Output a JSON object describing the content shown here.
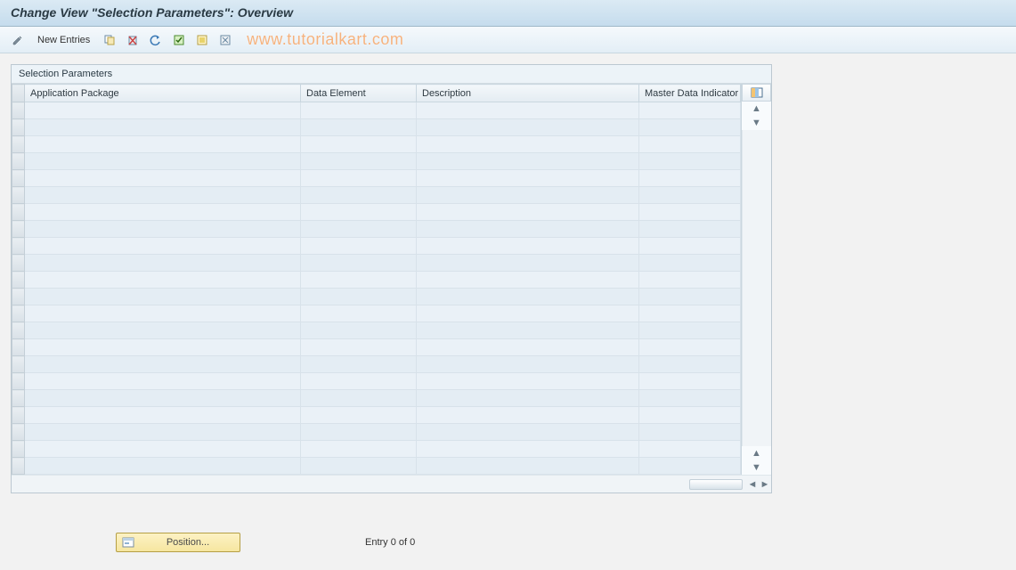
{
  "title": "Change View \"Selection Parameters\": Overview",
  "toolbar": {
    "new_entries": "New Entries"
  },
  "watermark": "www.tutorialkart.com",
  "panel": {
    "title": "Selection Parameters",
    "columns": {
      "application_package": "Application Package",
      "data_element": "Data Element",
      "description": "Description",
      "master_data_indicator": "Master Data Indicator"
    },
    "rows": [
      {},
      {},
      {},
      {},
      {},
      {},
      {},
      {},
      {},
      {},
      {},
      {},
      {},
      {},
      {},
      {},
      {},
      {},
      {},
      {},
      {},
      {}
    ]
  },
  "footer": {
    "position_button": "Position...",
    "entry_status": "Entry 0 of 0"
  }
}
